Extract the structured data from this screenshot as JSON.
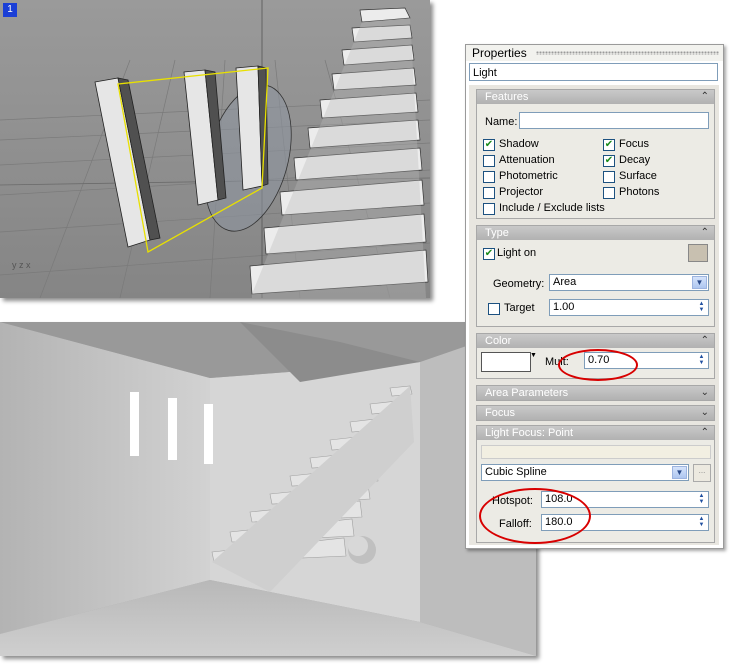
{
  "viewport": {
    "badge": "1",
    "axis_label": "y z x"
  },
  "properties": {
    "title": "Properties",
    "object_type": "Light",
    "features": {
      "header": "Features",
      "name_label": "Name:",
      "name_value": "",
      "checkboxes": [
        {
          "label": "Shadow",
          "checked": true
        },
        {
          "label": "Focus",
          "checked": true
        },
        {
          "label": "Attenuation",
          "checked": false
        },
        {
          "label": "Decay",
          "checked": true
        },
        {
          "label": "Photometric",
          "checked": false
        },
        {
          "label": "Surface",
          "checked": false
        },
        {
          "label": "Projector",
          "checked": false
        },
        {
          "label": "Photons",
          "checked": false
        },
        {
          "label": "Include / Exclude lists",
          "checked": false
        }
      ]
    },
    "type": {
      "header": "Type",
      "light_on_label": "Light on",
      "geometry_label": "Geometry:",
      "geometry_value": "Area",
      "target_label": "Target",
      "target_value": "1.00"
    },
    "color": {
      "header": "Color",
      "mult_label": "Mult:",
      "mult_value": "0.70"
    },
    "area_parameters": {
      "header": "Area Parameters"
    },
    "focus": {
      "header": "Focus"
    },
    "light_focus": {
      "header": "Light Focus: Point",
      "curve_value": "Cubic Spline",
      "hotspot_label": "Hotspot:",
      "hotspot_value": "108.0",
      "falloff_label": "Falloff:",
      "falloff_value": "180.0"
    }
  },
  "colors": {
    "annotation": "#d80000",
    "badge": "#1b3fd6",
    "checkmark": "#1a8a1a"
  }
}
